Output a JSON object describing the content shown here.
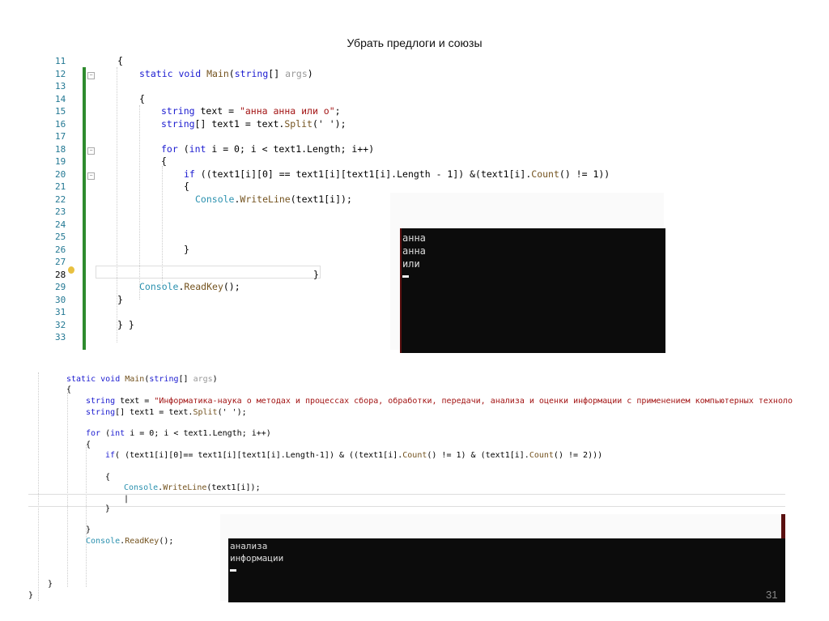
{
  "slide": {
    "title": "Убрать предлоги и союзы",
    "page_number": "31"
  },
  "colors": {
    "keyword": "#1b1bd0",
    "string": "#a31515",
    "method": "#74531f",
    "type": "#2b91af",
    "change_bar": "#2e8b2e"
  },
  "top_editor": {
    "line_numbers": [
      "11",
      "12",
      "13",
      "14",
      "15",
      "16",
      "17",
      "18",
      "19",
      "20",
      "21",
      "22",
      "23",
      "24",
      "25",
      "26",
      "27",
      "28",
      "29",
      "30",
      "31",
      "32",
      "33"
    ],
    "lines": [
      [
        [
          "{",
          ""
        ]
      ],
      [
        [
          "static void ",
          "kw"
        ],
        [
          "Main",
          "me"
        ],
        [
          "(",
          ""
        ],
        [
          "string",
          "kw"
        ],
        [
          "[] ",
          ""
        ],
        [
          "args",
          "pa"
        ],
        [
          ")",
          ""
        ]
      ],
      [],
      [
        [
          "{",
          ""
        ]
      ],
      [
        [
          "string ",
          "kw"
        ],
        [
          "text = ",
          ""
        ],
        [
          "\"анна анна или о\"",
          "st"
        ],
        [
          ";",
          ""
        ]
      ],
      [
        [
          "string",
          "kw"
        ],
        [
          "[] text1 = text.",
          ""
        ],
        [
          "Split",
          "me"
        ],
        [
          "(' ');",
          ""
        ]
      ],
      [],
      [
        [
          "for ",
          "kw"
        ],
        [
          "(",
          ""
        ],
        [
          "int ",
          "kw"
        ],
        [
          "i = 0; i < text1.Length; i++)",
          ""
        ]
      ],
      [
        [
          "{",
          ""
        ]
      ],
      [
        [
          "if ",
          "kw"
        ],
        [
          "((text1[i][0] == text1[i][text1[i].Length - 1]) &(text1[i].",
          ""
        ],
        [
          "Count",
          "me"
        ],
        [
          "() != 1))",
          ""
        ]
      ],
      [
        [
          "{",
          ""
        ]
      ],
      [
        [
          "Console",
          "ty"
        ],
        [
          ".",
          ""
        ],
        [
          "WriteLine",
          "me"
        ],
        [
          "(text1[i]);",
          ""
        ]
      ],
      [],
      [],
      [],
      [
        [
          "}",
          ""
        ]
      ],
      [],
      [
        [
          "}",
          ""
        ]
      ],
      [
        [
          "Console",
          "ty"
        ],
        [
          ".",
          ""
        ],
        [
          "ReadKey",
          "me"
        ],
        [
          "();",
          ""
        ]
      ],
      [
        [
          "}",
          ""
        ]
      ],
      [],
      [
        [
          "} }",
          ""
        ]
      ],
      []
    ],
    "console_output": [
      "анна",
      "анна",
      "или"
    ]
  },
  "bottom_editor": {
    "lines": [
      [
        [
          "static void ",
          "kw"
        ],
        [
          "Main",
          "me"
        ],
        [
          "(",
          ""
        ],
        [
          "string",
          "kw"
        ],
        [
          "[] ",
          ""
        ],
        [
          "args",
          "pa"
        ],
        [
          ")",
          ""
        ]
      ],
      [
        [
          "{",
          ""
        ]
      ],
      [
        [
          "string ",
          "kw"
        ],
        [
          "text = ",
          ""
        ],
        [
          "\"Информатика-наука о методах и процессах сбора, обработки, передачи, анализа и оценки информации с применением компьютерных техноло",
          "st"
        ]
      ],
      [
        [
          "string",
          "kw"
        ],
        [
          "[] text1 = text.",
          ""
        ],
        [
          "Split",
          "me"
        ],
        [
          "(' ');",
          ""
        ]
      ],
      [
        [
          "for ",
          "kw"
        ],
        [
          "(",
          ""
        ],
        [
          "int ",
          "kw"
        ],
        [
          "i = 0; i < text1.Length; i++)",
          ""
        ]
      ],
      [
        [
          "{",
          ""
        ]
      ],
      [
        [
          "if",
          "kw"
        ],
        [
          "( (text1[i][0]== text1[i][text1[i].Length-1]) & ((text1[i].",
          ""
        ],
        [
          "Count",
          "me"
        ],
        [
          "() != 1) & (text1[i].",
          ""
        ],
        [
          "Count",
          "me"
        ],
        [
          "() != 2)))",
          ""
        ]
      ],
      [
        [
          "{",
          ""
        ]
      ],
      [
        [
          "Console",
          "ty"
        ],
        [
          ".",
          ""
        ],
        [
          "WriteLine",
          "me"
        ],
        [
          "(text1[i]);",
          ""
        ]
      ],
      [
        [
          "|",
          ""
        ]
      ],
      [
        [
          "}",
          ""
        ]
      ],
      [
        [
          "}",
          ""
        ]
      ],
      [
        [
          "Console",
          "ty"
        ],
        [
          ".",
          ""
        ],
        [
          "ReadKey",
          "me"
        ],
        [
          "();",
          ""
        ]
      ],
      [
        [
          "}",
          ""
        ]
      ],
      [
        [
          "}",
          ""
        ]
      ]
    ],
    "console_output": [
      "анализа",
      "информации"
    ]
  }
}
